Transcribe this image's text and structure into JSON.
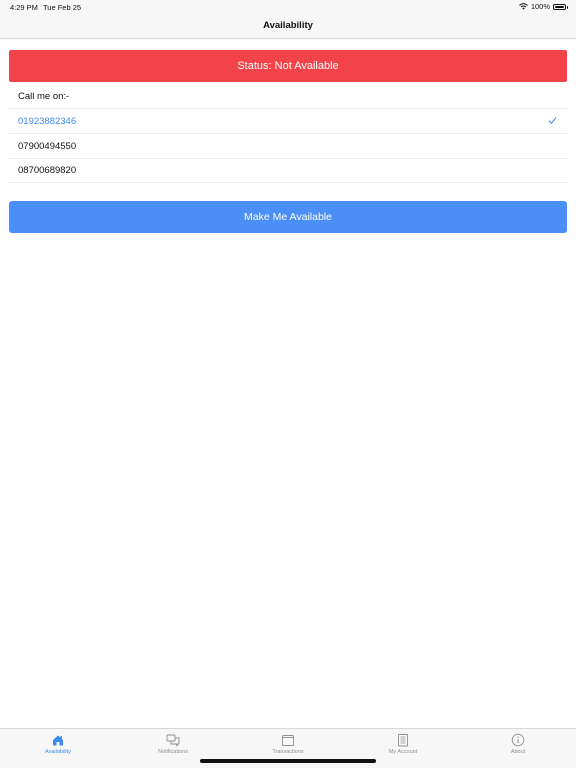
{
  "status_bar": {
    "time": "4:29 PM",
    "date": "Tue Feb 25",
    "battery": "100%"
  },
  "nav": {
    "title": "Availability"
  },
  "status_banner": {
    "text": "Status: Not Available",
    "color": "#f2424a"
  },
  "call_section": {
    "header": "Call me on:-",
    "numbers": [
      {
        "number": "01923882346",
        "selected": true
      },
      {
        "number": "07900494550",
        "selected": false
      },
      {
        "number": "08700689820",
        "selected": false
      }
    ]
  },
  "action": {
    "label": "Make Me Available",
    "color": "#4a8ff7"
  },
  "tabs": [
    {
      "label": "Availability",
      "icon": "home-icon",
      "active": true
    },
    {
      "label": "Notifications",
      "icon": "chat-bubbles-icon",
      "active": false
    },
    {
      "label": "Transactions",
      "icon": "folder-icon",
      "active": false
    },
    {
      "label": "My Account",
      "icon": "document-icon",
      "active": false
    },
    {
      "label": "About",
      "icon": "info-icon",
      "active": false
    }
  ],
  "accent_color": "#3d8bf2"
}
